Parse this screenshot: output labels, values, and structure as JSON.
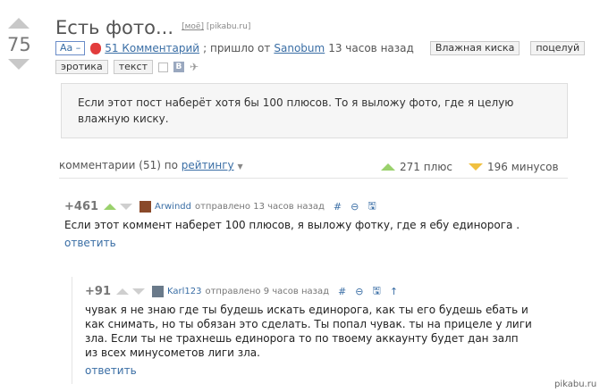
{
  "post": {
    "score": "75",
    "title": "Есть фото...",
    "source_mine": "[моё]",
    "source_site": "[pikabu.ru]",
    "aa_label": "Аа –",
    "comments_link": "51 Комментарий",
    "came_from_text": "; пришло от",
    "author": "Sanobum",
    "time": "13 часов назад",
    "tags": [
      "Влажная киска",
      "поцелуй",
      "эротика",
      "текст"
    ],
    "body": "Если этот пост наберёт хотя бы 100 плюсов. То я выложу фото, где я целую влажную киску."
  },
  "comments_header": {
    "label": "комментарии (51) по",
    "sort": "рейтингу",
    "pluses": "271 плюс",
    "minuses": "196 минусов"
  },
  "comments": [
    {
      "score": "+461",
      "user": "Arwindd",
      "sent": "отправлено 13 часов назад",
      "actions": [
        "#",
        "⊖",
        "🖫"
      ],
      "text": "Если этот коммент наберет 100 плюсов, я выложу фотку, где я ебу единорога .",
      "reply": "ответить"
    },
    {
      "score": "+91",
      "user": "Karl123",
      "sent": "отправлено 9 часов назад",
      "actions": [
        "#",
        "⊖",
        "🖫",
        "↑"
      ],
      "text": "чувак я не знаю где ты будешь искать единорога, как ты его будешь ебать и как снимать, но ты обязан это сделать. Ты попал чувак. ты на прицеле у лиги зла. Если ты не трахнешь единорога то по твоему аккаунту будет дан залп из всех минусометов лиги зла.",
      "reply": "ответить"
    }
  ],
  "watermark": "pikabu.ru",
  "colors": {
    "link": "#3a6ea5",
    "plus": "#9ad16c",
    "minus": "#f0c040"
  }
}
